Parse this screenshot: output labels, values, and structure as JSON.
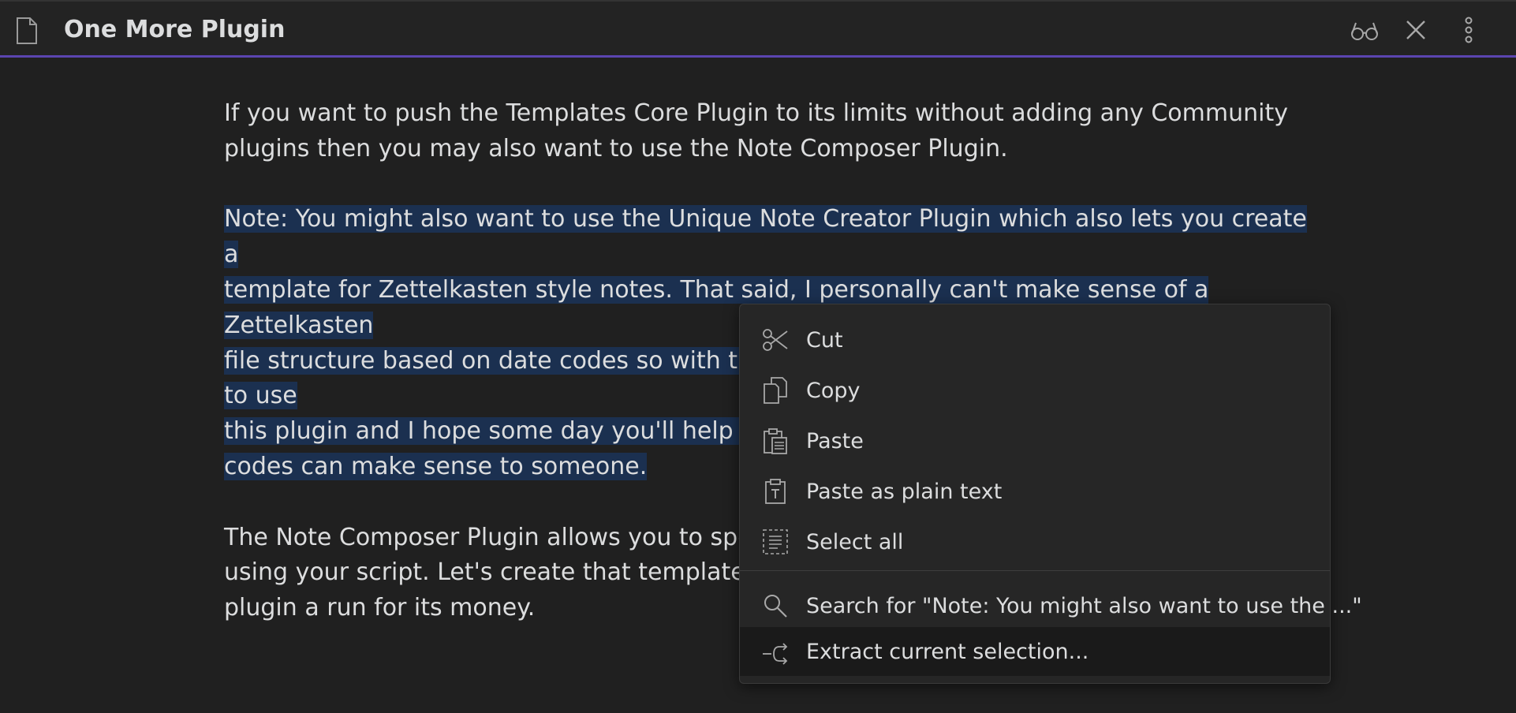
{
  "header": {
    "title": "One More Plugin",
    "file_icon": "file-icon",
    "actions": [
      {
        "name": "reading-view-icon"
      },
      {
        "name": "close-icon"
      },
      {
        "name": "more-options-icon"
      }
    ]
  },
  "document": {
    "paragraphs": [
      "If you want to push the Templates Core Plugin to its limits without adding any Community plugins then you may also want to use the Note Composer Plugin.",
      "Note: You might also want to use the Unique Note Creator Plugin which also lets you create a template for Zettelkasten style notes. That said, I personally can't make sense of a Zettelkasten file structure based on date codes so with the information you already have you'll be able to use this plugin and I hope some day you'll help me understand how a Zettelkasten based on date codes can make sense to someone.",
      "The Note Composer Plugin allows you to specify a template that will be applied to notes created using your script. Let's create that template first and then give the Note Composer Core plugin a run for its money."
    ],
    "visible_lines": {
      "p1": [
        "If you want to push the Templates Core Plugin to its limits without adding any Community",
        "plugins then you may also want to use the Note Composer Plugin."
      ],
      "p2": [
        "Note: You might also want to use the Unique Note Creator Plugin which also lets you create a",
        "template for Zettelkasten style notes. That said, I personally can't make sense of a Zettelkasten",
        "file structure based on date codes so with the information you already have you'll be able to use",
        "this plugin and I hope some day you'll help me",
        "codes can make sense to someone."
      ],
      "p3": [
        "The Note Composer Plugin allows you to spec",
        "using your script. Let's create that template firs",
        "plugin a run for its money."
      ]
    },
    "selection_color": "#1b3050"
  },
  "context_menu": {
    "items": [
      {
        "label": "Cut",
        "icon": "scissors-icon"
      },
      {
        "label": "Copy",
        "icon": "copy-icon"
      },
      {
        "label": "Paste",
        "icon": "clipboard-icon"
      },
      {
        "label": "Paste as plain text",
        "icon": "clipboard-text-icon"
      },
      {
        "label": "Select all",
        "icon": "select-all-icon"
      },
      {
        "label": "Search for \"Note: You might also want to use the ...\"",
        "icon": "search-icon"
      },
      {
        "label": "Extract current selection...",
        "icon": "extract-icon"
      }
    ],
    "highlighted_item": "Extract current selection..."
  },
  "colors": {
    "background": "#202020",
    "text": "#dcddde",
    "accent": "#5b45b0"
  }
}
